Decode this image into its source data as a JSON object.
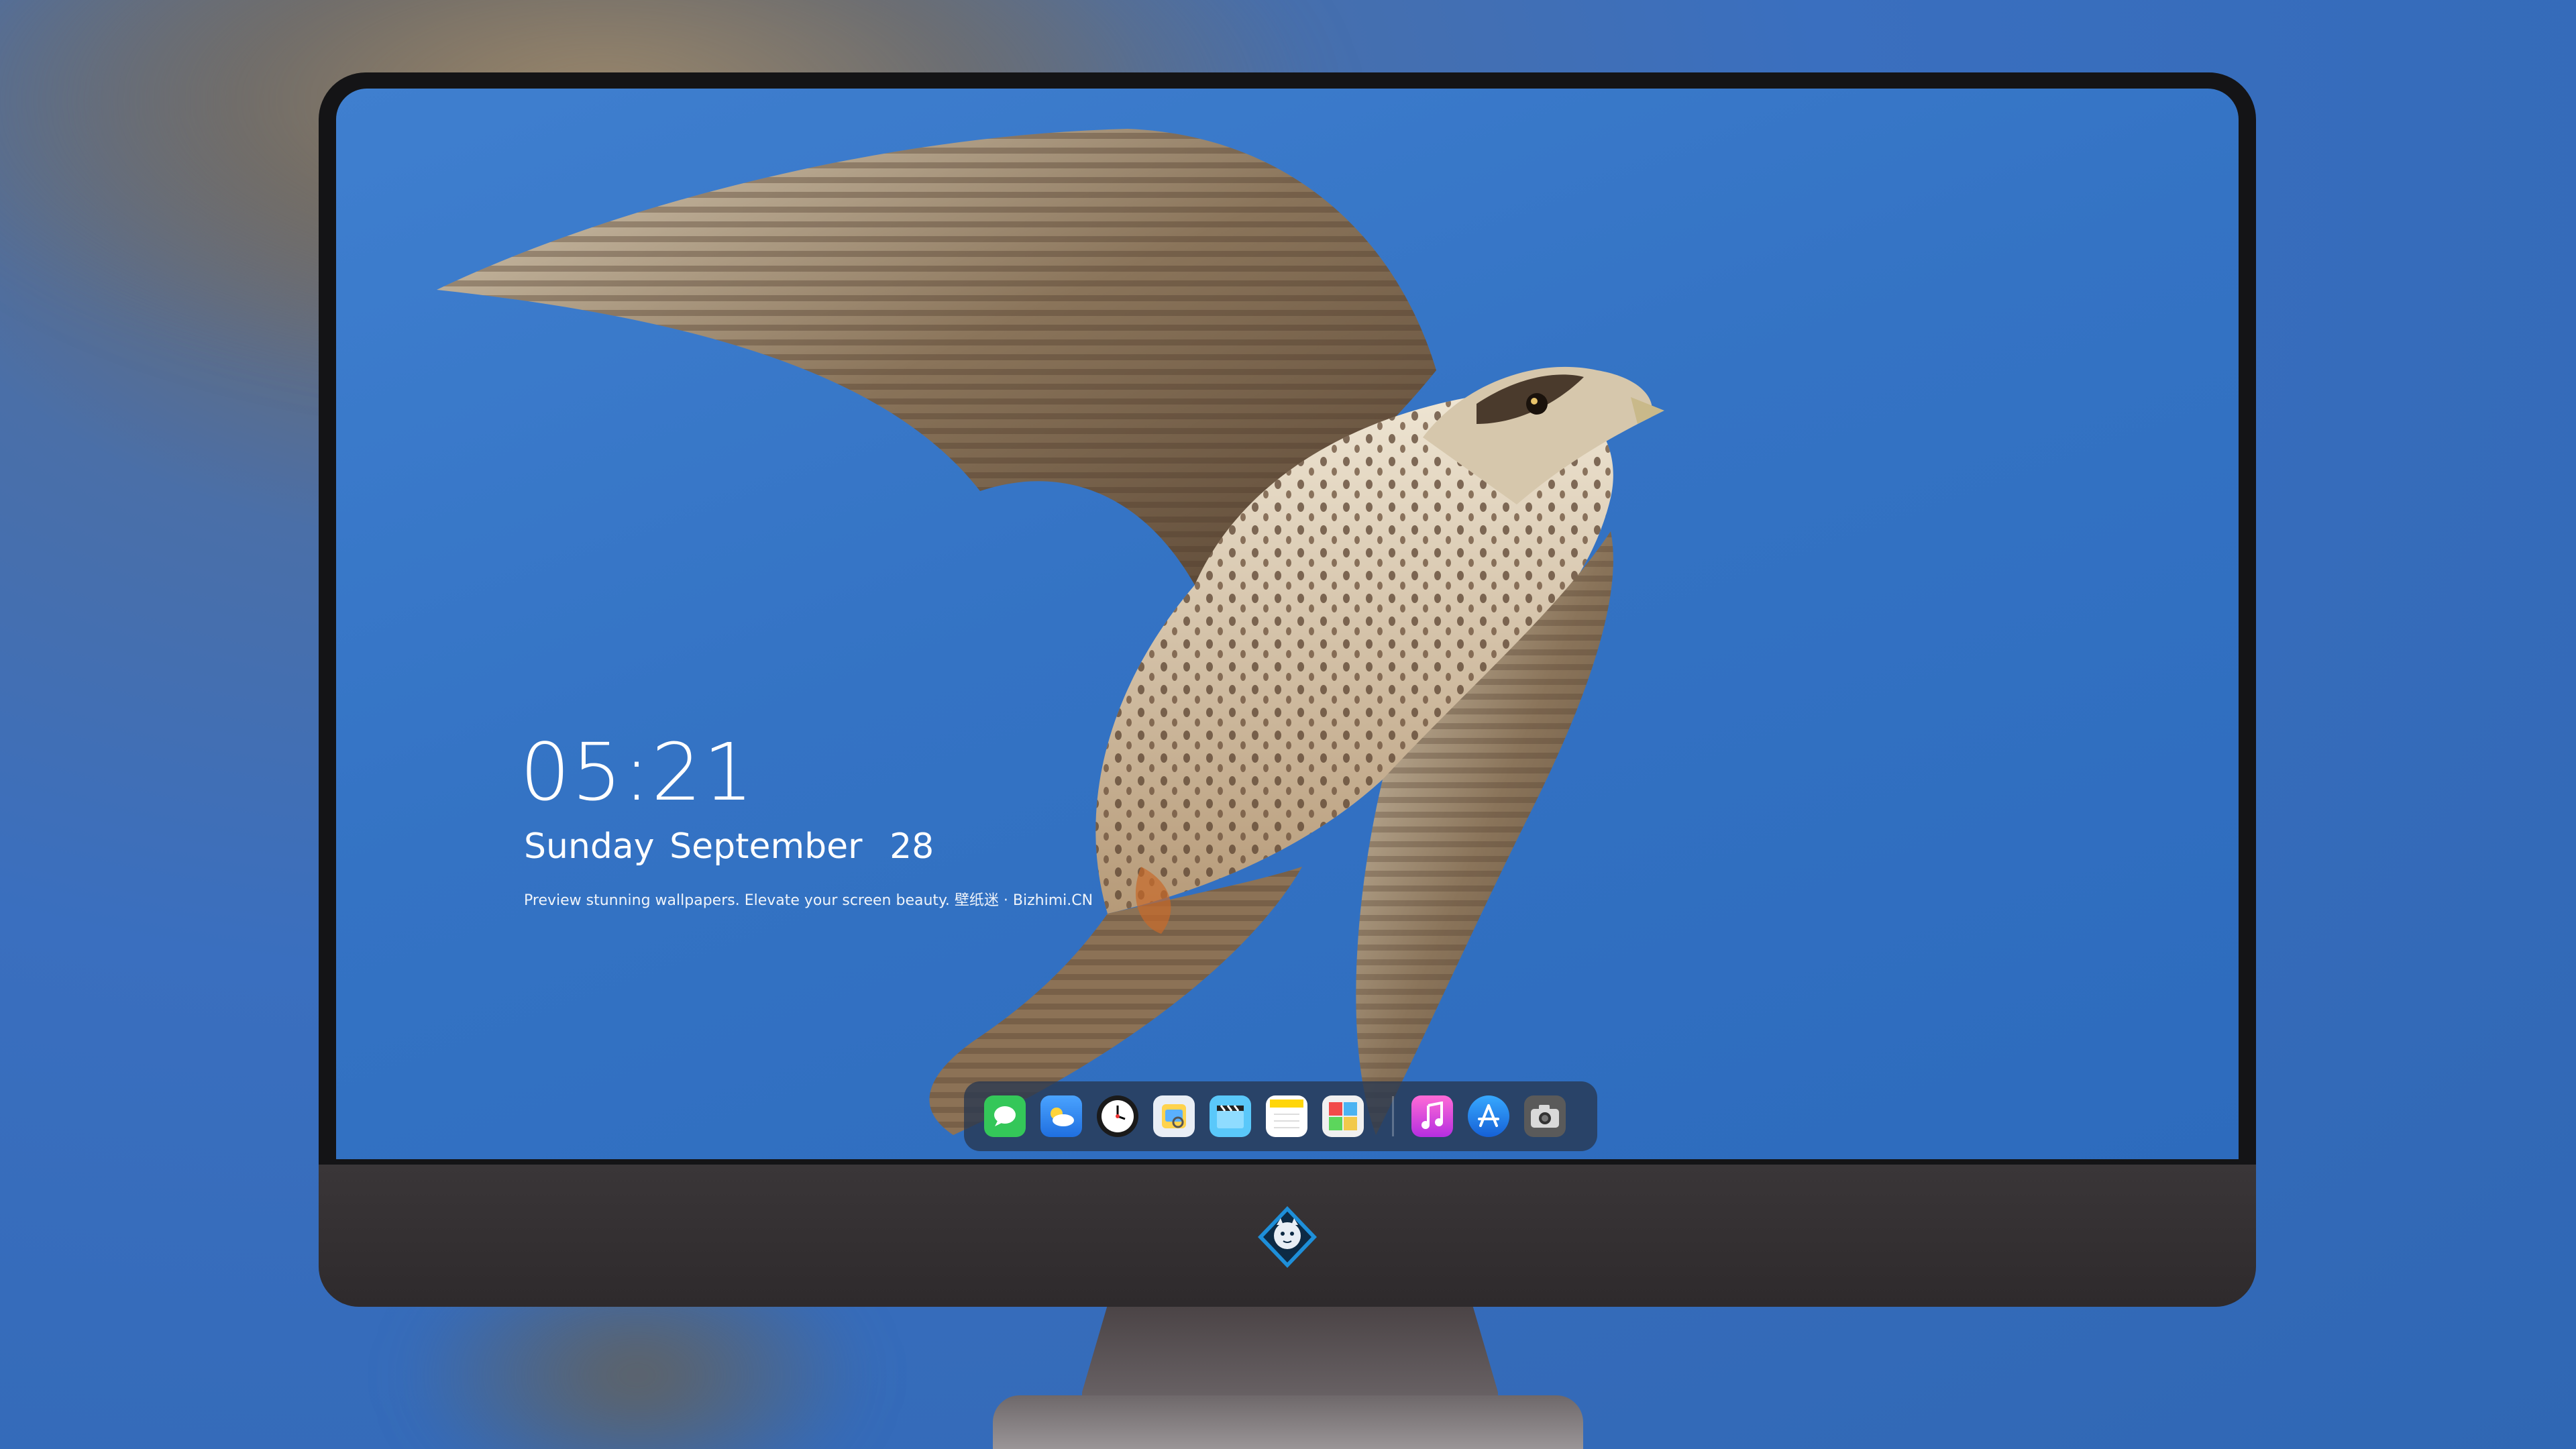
{
  "lockscreen": {
    "time": "05:21",
    "weekday": "Sunday",
    "month": "September",
    "day": "28",
    "tagline": "Preview stunning wallpapers. Elevate your screen beauty. 壁纸迷 · Bizhimi.CN"
  },
  "dock": {
    "apps": [
      {
        "name": "messages-icon",
        "color": "#34c759"
      },
      {
        "name": "weather-icon",
        "color": "#2f8ff0"
      },
      {
        "name": "clock-icon",
        "color": "#1a1a1a"
      },
      {
        "name": "preview-icon",
        "color": "#f2c94c"
      },
      {
        "name": "clips-icon",
        "color": "#5ac8fa"
      },
      {
        "name": "notes-icon",
        "color": "#ffd60a"
      },
      {
        "name": "photo-booth-icon",
        "color": "#e0e0e0"
      },
      {
        "name": "music-icon",
        "color": "#e33ad1"
      },
      {
        "name": "app-store-icon",
        "color": "#1a8cff"
      },
      {
        "name": "camera-icon",
        "color": "#555555"
      }
    ]
  },
  "colors": {
    "sky": "#3473c4",
    "bezel": "#141416",
    "chin": "#332f31"
  }
}
